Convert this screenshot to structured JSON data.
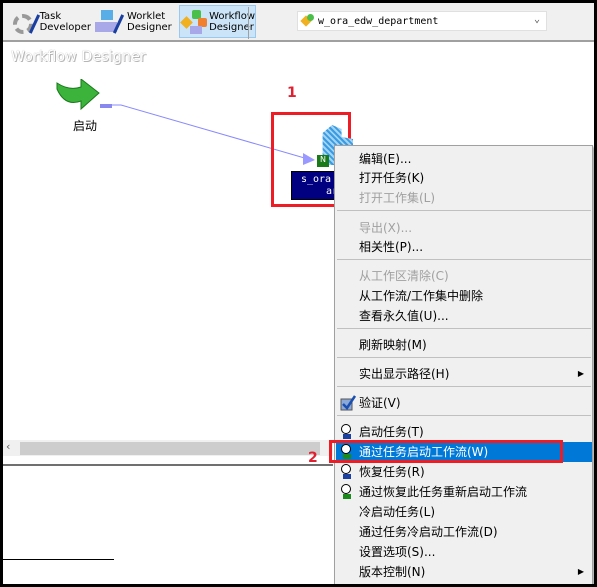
{
  "toolbar": {
    "buttons": [
      {
        "line1": "Task",
        "line2": "Developer",
        "active": false
      },
      {
        "line1": "Worklet",
        "line2": "Designer",
        "active": false
      },
      {
        "line1": "Workflow",
        "line2": "Designer",
        "active": true
      }
    ],
    "workflow_select": "w_ora_edw_department"
  },
  "canvas": {
    "title": "Workflow Designer",
    "start_label": "启动",
    "task_line1": "s_ora",
    "task_line2": "ar",
    "annotation_1": "1",
    "annotation_2": "2"
  },
  "context_menu": {
    "items": [
      {
        "label": "编辑(E)...",
        "disabled": false
      },
      {
        "label": "打开任务(K)",
        "disabled": false
      },
      {
        "label": "打开工作集(L)",
        "disabled": true
      },
      {
        "label": "导出(X)...",
        "disabled": true
      },
      {
        "label": "相关性(P)...",
        "disabled": false
      },
      {
        "label": "从工作区清除(C)",
        "disabled": true
      },
      {
        "label": "从工作流/工作集中删除",
        "disabled": false
      },
      {
        "label": "查看永久值(U)...",
        "disabled": false
      },
      {
        "label": "刷新映射(M)",
        "disabled": false
      },
      {
        "label": "实出显示路径(H)",
        "disabled": false,
        "submenu": true
      },
      {
        "label": "验证(V)",
        "disabled": false,
        "icon": "validate-check-icon"
      },
      {
        "label": "启动任务(T)",
        "disabled": false,
        "icon": "clock-start-icon"
      },
      {
        "label": "通过任务启动工作流(W)",
        "disabled": false,
        "icon": "clock-start-workflow-icon",
        "highlighted": true
      },
      {
        "label": "恢复任务(R)",
        "disabled": false,
        "icon": "clock-recover-icon"
      },
      {
        "label": "通过恢复此任务重新启动工作流",
        "disabled": false,
        "icon": "clock-restart-icon"
      },
      {
        "label": "冷启动任务(L)",
        "disabled": false
      },
      {
        "label": "通过任务冷启动工作流(D)",
        "disabled": false
      },
      {
        "label": "设置选项(S)...",
        "disabled": false
      },
      {
        "label": "版本控制(N)",
        "disabled": false,
        "submenu": true
      }
    ]
  },
  "colors": {
    "highlight": "#0078d7",
    "annotation_red": "#ee1c25",
    "task_box": "#000080"
  }
}
